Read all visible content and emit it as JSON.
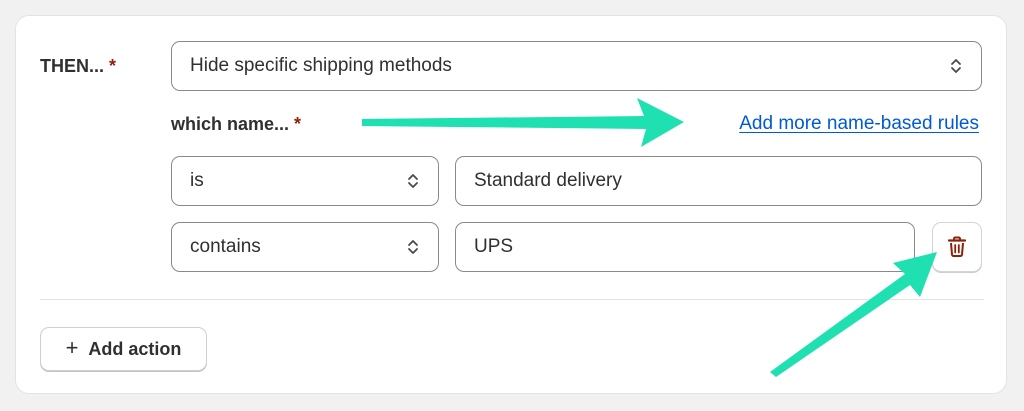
{
  "then": {
    "label": "THEN...",
    "required_mark": "*"
  },
  "action_select": {
    "value": "Hide specific shipping methods"
  },
  "which_name": {
    "label": "which name...",
    "required_mark": "*"
  },
  "add_rules_link": {
    "label": "Add more name-based rules"
  },
  "rules": [
    {
      "operator": "is",
      "value": "Standard delivery"
    },
    {
      "operator": "contains",
      "value": "UPS"
    }
  ],
  "add_action_button": {
    "icon": "plus-icon",
    "label": "Add action"
  },
  "delete_button": {
    "icon": "trash-icon"
  },
  "colors": {
    "accent_link": "#005bd3",
    "required": "#8e1f0b",
    "delete_icon": "#8e1f0b",
    "annotation_arrow": "#1ee0b0"
  }
}
